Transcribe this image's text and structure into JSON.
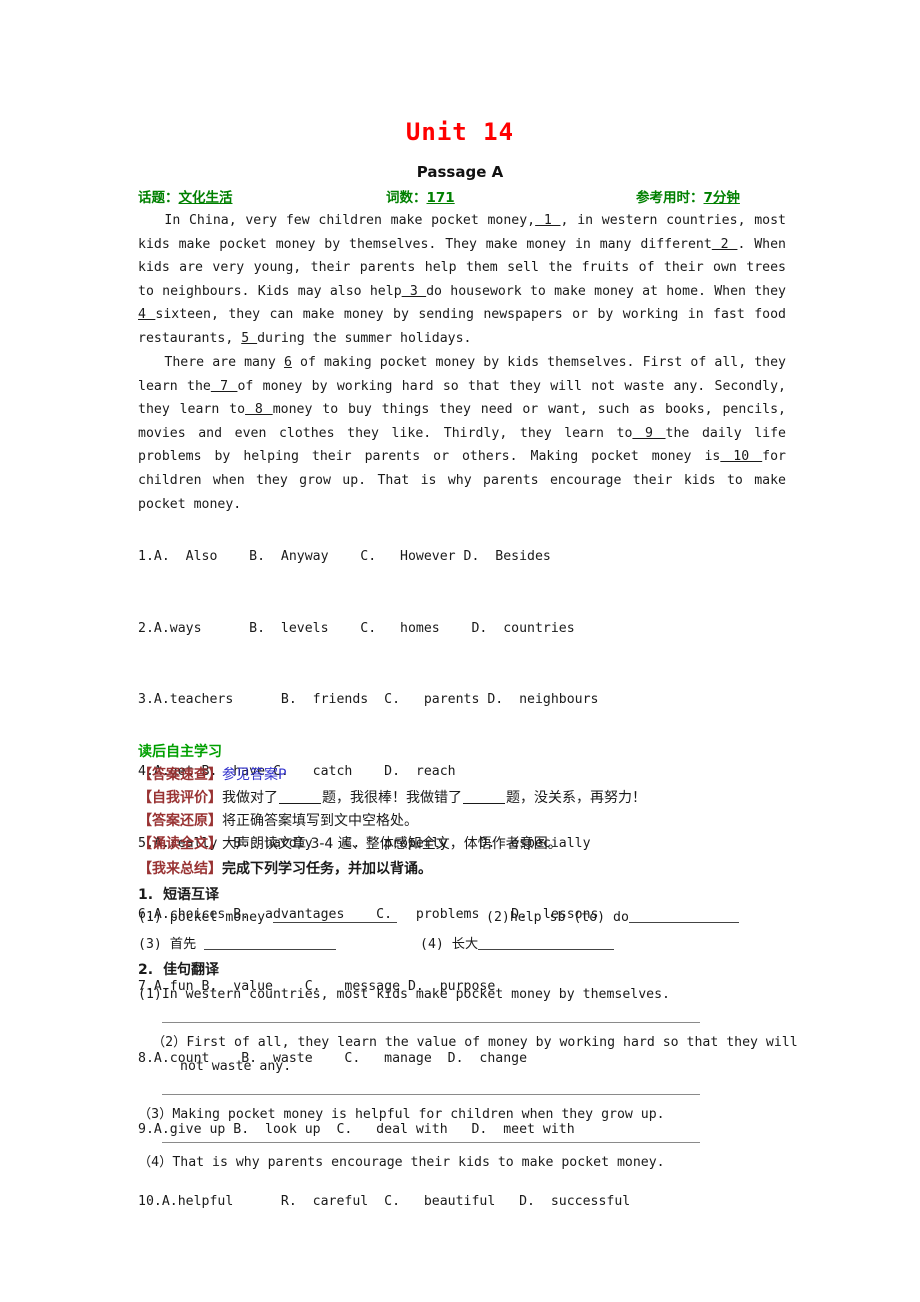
{
  "document": {
    "unit_title": "Unit 14",
    "passage_title": "Passage A"
  },
  "meta": {
    "topic_label": "话题：",
    "topic_value": "文化生活 ",
    "words_label": "词数：",
    "words_value": "171",
    "time_label": "参考用时：",
    "time_value": "7分钟",
    "color": "#008000"
  },
  "passage": {
    "para1_a": "In China, very few children make pocket money,",
    "para1_b1": " 1 ",
    "para1_c": ", in western countries, most kids make pocket money by themselves. They make money in many different",
    "para1_b2": " 2 ",
    "para1_d": ". When kids are very young, their parents help them sell the fruits of their own trees to neighbours. Kids may also help",
    "para1_b3": "  3  ",
    "para1_e": "do housework to make money at home. When they ",
    "para1_b4": "4 ",
    "para1_f": "sixteen, they can make money by sending newspapers or by working in fast food restaurants, ",
    "para1_b5": "  5 ",
    "para1_g": "during the summer holidays.",
    "para2_a": "There are many ",
    "para2_b1": "6",
    "para2_b": " of making pocket money by kids themselves. First of all, they learn the",
    "para2_b2": " 7 ",
    "para2_c": "of money by working hard so that they will not waste any. Secondly, they learn to",
    "para2_b3": " 8 ",
    "para2_d": " money to buy things they need or want, such as books, pencils, movies and even clothes they like. Thirdly, they learn to",
    "para2_b4": " 9 ",
    "para2_e": "the daily life problems by helping their parents or others. Making pocket money is",
    "para2_b5": " 10 ",
    "para2_f": "for children when they grow up. That is why parents encourage their kids to make pocket money."
  },
  "options": [
    "1.A.  Also    B.  Anyway    C.   However D.  Besides",
    "2.A.ways      B.  levels    C.   homes    D.  countries",
    "3.A.teachers      B.  friends  C.   parents D.  neighbours",
    "4.A.get B.  have C.   catch    D.  reach",
    "5.A.really  B.  hardly    C.   properly    D.  especially",
    "6.A.choices B.  advantages    C.   problems    D.  lessons",
    "7.A.fun B.  value    C.   message D.  purpose",
    "8.A.count    B.  waste    C.   manage  D.  change",
    "9.A.give up B.  look up  C.   deal with   D.  meet with",
    "10.A.helpful      R.  careful  C.   beautiful   D.  successful"
  ],
  "study": {
    "heading": "读后自主学习",
    "answer_tag": "【答案速查】",
    "answer_text": "参见答案P",
    "selfeval_tag": "【自我评价】",
    "selfeval_a": "我做对了",
    "selfeval_b": "题，我很棒！我做错了",
    "selfeval_c": "题，没关系，再努力！",
    "restore_tag": "【答案还原】",
    "restore_text": "将正确答案填写到文中空格处。",
    "read_tag": "【诵读全文】",
    "read_text": "大声朗读文章 3-4 遍、整体感知全文，体悟作者意图。",
    "summary_tag": "【我来总结】",
    "summary_text": "完成下列学习任务，并加以背诵。"
  },
  "task1": {
    "number": "1.",
    "title": "短语互译",
    "items": [
      {
        "label": "(1)",
        "text": "pocket money"
      },
      {
        "label": "(2)",
        "text": "help sb (to) do"
      },
      {
        "label": "(3)",
        "text": "首先"
      },
      {
        "label": "(4)",
        "text": "长大"
      }
    ]
  },
  "task2": {
    "number": "2.",
    "title": "佳句翻译",
    "sentences": [
      {
        "label": "(1)",
        "text": "In western countries, most kids make pocket money by themselves."
      },
      {
        "label": "（2）",
        "line1": "First of all, they learn the value of money by working hard so that they will",
        "line2": "not waste any."
      },
      {
        "label": "（3）",
        "text": "Making pocket money is helpful for children when they grow up."
      },
      {
        "label": "（4）",
        "text": "That is why parents encourage their kids to make pocket money."
      }
    ]
  }
}
